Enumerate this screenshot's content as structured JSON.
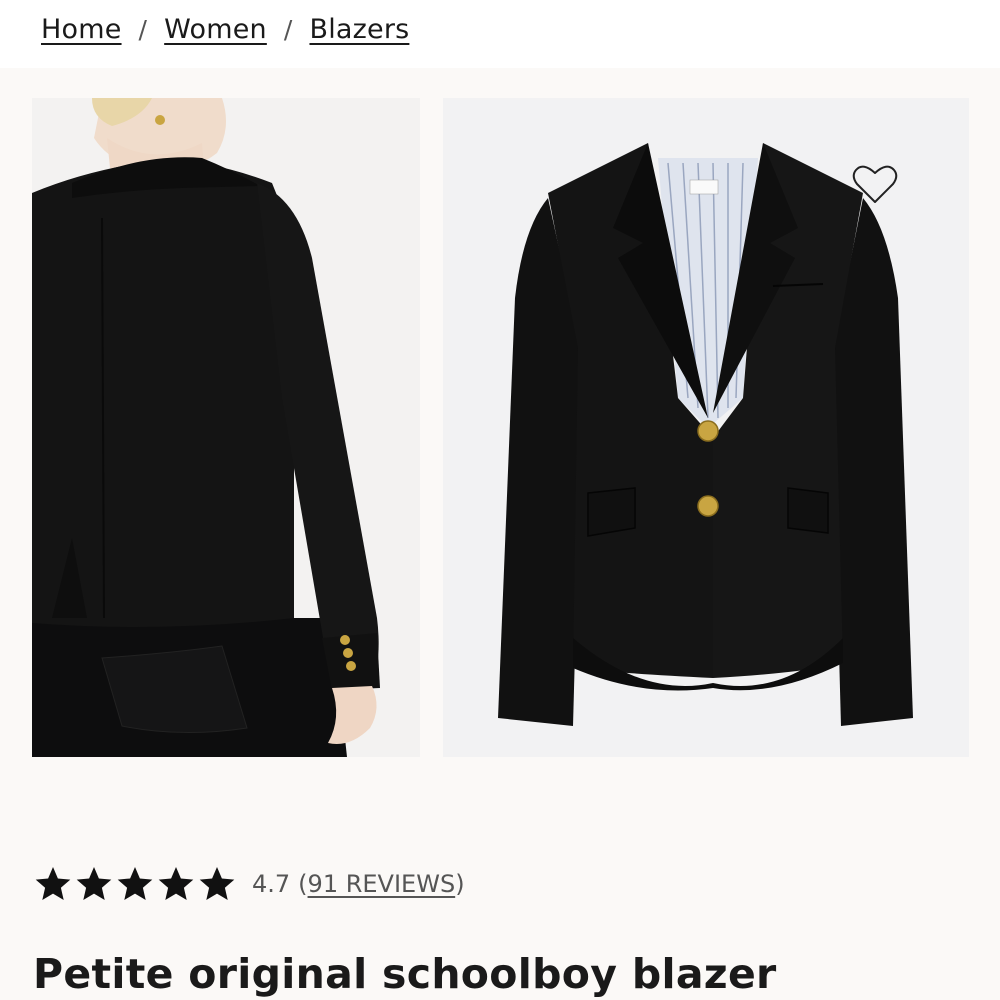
{
  "breadcrumb": {
    "items": [
      "Home",
      "Women",
      "Blazers"
    ],
    "separator": "/"
  },
  "gallery": {
    "images": [
      {
        "alt": "back-view-model-image"
      },
      {
        "alt": "front-view-product-image"
      }
    ],
    "wishlist_icon": "heart-outline-icon"
  },
  "rating": {
    "stars": 5,
    "value": "4.7",
    "reviews_label": "(91 REVIEWS)",
    "reviews_text": "91 REVIEWS"
  },
  "product": {
    "title": "Petite original schoolboy blazer"
  },
  "colors": {
    "page_bg": "#fbf9f7",
    "text": "#1a1a1a",
    "muted": "#555555",
    "button_gold": "#c9a542"
  }
}
